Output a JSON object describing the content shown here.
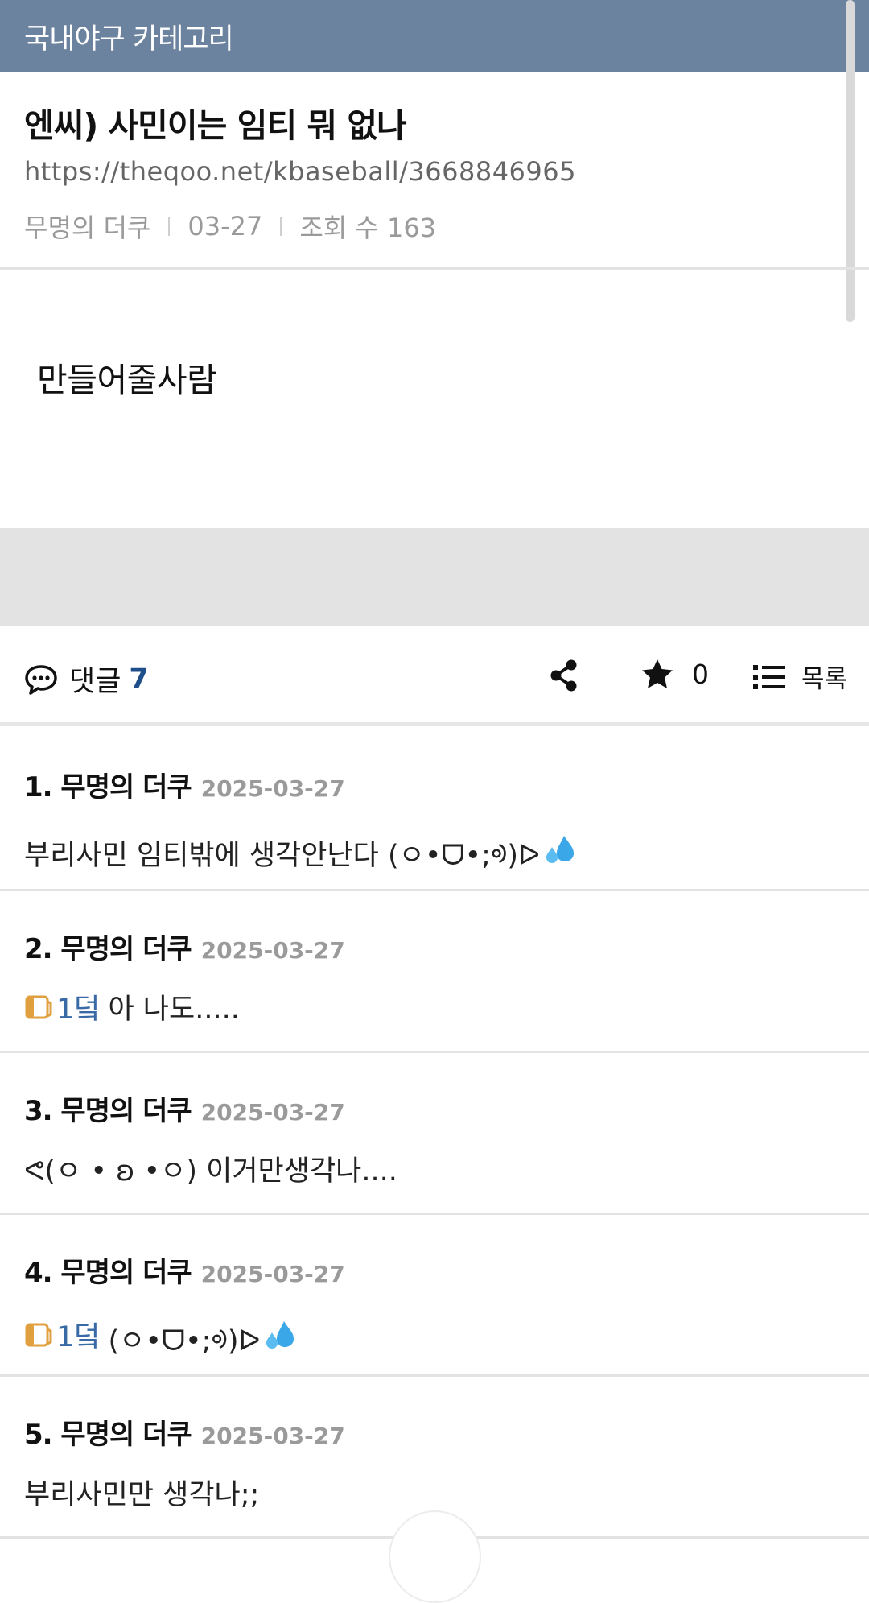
{
  "header": {
    "title": "국내야구 카테고리"
  },
  "post": {
    "title": "엔씨) 사민이는 임티 뭐 없나",
    "url": "https://theqoo.net/kbaseball/3668846965",
    "author": "무명의 더쿠",
    "date": "03-27",
    "views": "조회 수 163",
    "body": "만들어줄사람"
  },
  "actions": {
    "comment_label": "댓글",
    "comment_count": "7",
    "star_count": "0",
    "list_label": "목록"
  },
  "comments": [
    {
      "author": "1. 무명의 더쿠",
      "date": "2025-03-27",
      "reply_to": "",
      "text": "부리사민 임티밖에 생각안난다 (ㅇ•ᗜ•;ᢀ)ᐅ"
    },
    {
      "author": "2. 무명의 더쿠",
      "date": "2025-03-27",
      "reply_to": "1덬",
      "text": "아 나도....."
    },
    {
      "author": "3. 무명의 더쿠",
      "date": "2025-03-27",
      "reply_to": "",
      "text": "ᕙ(ㅇ • ʚ •ㅇ) 이거만생각나...."
    },
    {
      "author": "4. 무명의 더쿠",
      "date": "2025-03-27",
      "reply_to": "1덬",
      "text": "(ㅇ•ᗜ•;ᢀ)ᐅ"
    },
    {
      "author": "5. 무명의 더쿠",
      "date": "2025-03-27",
      "reply_to": "",
      "text": "부리사민만 생각나;;"
    }
  ],
  "icons": {
    "speech": "speech-bubble-icon",
    "share": "share-icon",
    "star": "star-icon",
    "list": "list-icon",
    "reply": "reply-book-icon",
    "sweat": "sweat-droplets-icon"
  },
  "colors": {
    "header_bg": "#6c83a0",
    "accent_blue": "#1f4f8a",
    "reply_blue": "#3a6aa5",
    "reply_icon": "#e0a040"
  }
}
